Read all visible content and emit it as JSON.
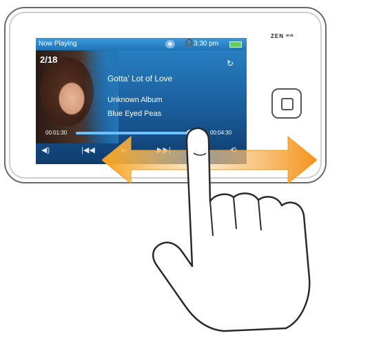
{
  "device": {
    "brand": "ZEN ᵐᶦᵏ",
    "screen": {
      "status_title": "Now Playing",
      "bluetooth_label": "✱",
      "time": "3:30 pm",
      "track_index": "2/18",
      "song_title": "Gotta' Lot of Love",
      "album": "Unknown Album",
      "artist": "Blue Eyed Peas",
      "elapsed": "00:01:30",
      "total": "00:04:30",
      "progress": 0.88,
      "controls": [
        "volume-icon",
        "prev-icon",
        "play-icon",
        "next-icon",
        "menu-icon",
        "back-icon"
      ]
    }
  },
  "colors": {
    "screen_blue": "#1f73b5",
    "arrow_orange": "#f39a17",
    "battery_green": "#5fd05a"
  }
}
